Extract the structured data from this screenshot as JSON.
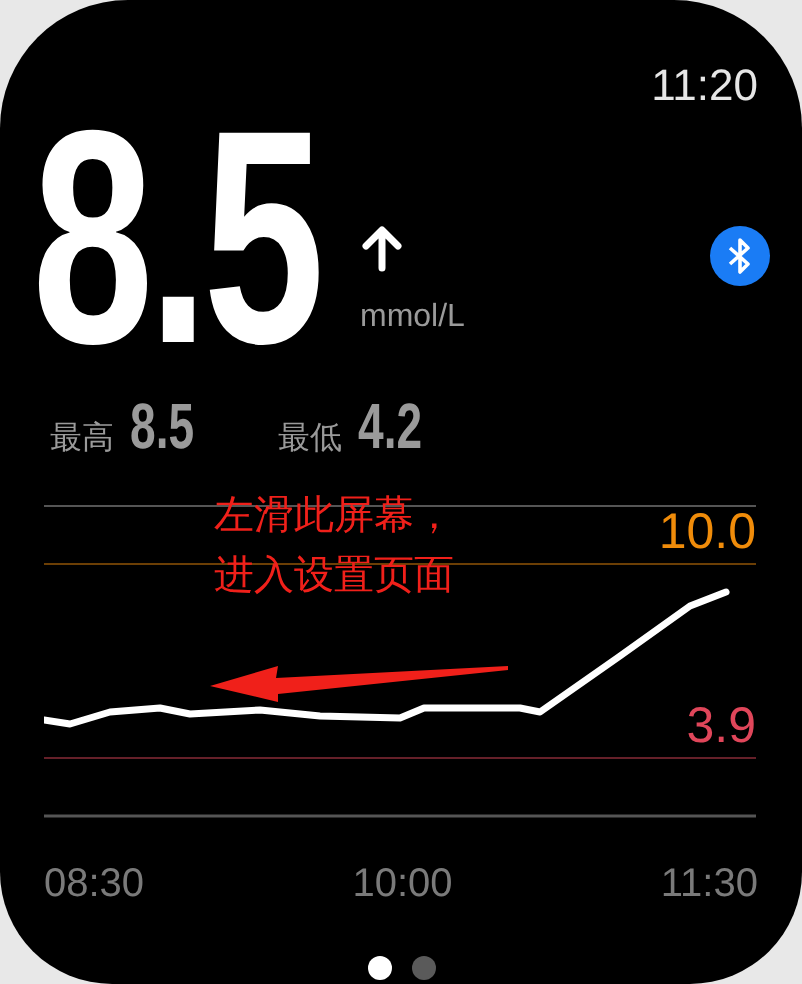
{
  "status_bar": {
    "time": "11:20"
  },
  "reading": {
    "value": "8.5",
    "trend_up": true,
    "unit": "mmol/L",
    "connected": true
  },
  "stats": [
    {
      "label": "最高",
      "value": "8.5"
    },
    {
      "label": "最低",
      "value": "4.2"
    }
  ],
  "chart": {
    "thresholds": [
      {
        "label": "10.0",
        "color": "#f08c0a"
      },
      {
        "label": "3.9",
        "color": "#e0465a"
      }
    ],
    "time_labels": [
      "08:30",
      "10:00",
      "11:30"
    ]
  },
  "annotation": {
    "lines": [
      "左滑此屏幕，",
      "进入设置页面"
    ]
  },
  "pages": [
    {
      "selected": true
    },
    {
      "selected": false
    }
  ]
}
